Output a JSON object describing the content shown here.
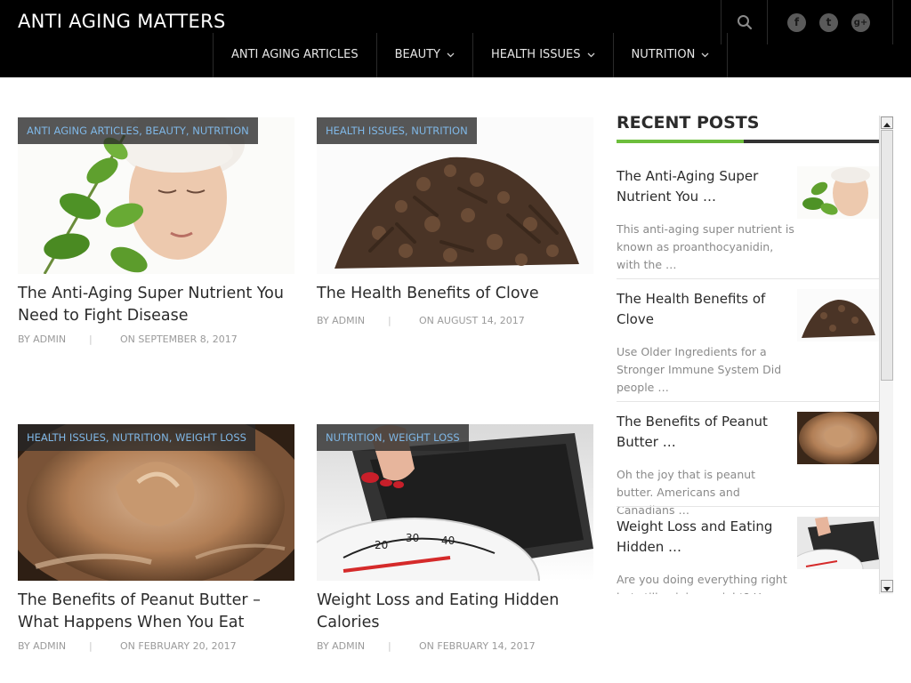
{
  "site": {
    "title": "ANTI AGING MATTERS"
  },
  "header": {
    "search_icon": "search-icon",
    "social": [
      {
        "name": "facebook-icon",
        "glyph": "f"
      },
      {
        "name": "twitter-icon",
        "glyph": "t"
      },
      {
        "name": "google-plus-icon",
        "glyph": "g+"
      }
    ]
  },
  "nav": {
    "items": [
      {
        "label": "ANTI AGING ARTICLES",
        "has_dropdown": false
      },
      {
        "label": "BEAUTY",
        "has_dropdown": true
      },
      {
        "label": "HEALTH ISSUES",
        "has_dropdown": true
      },
      {
        "label": "NUTRITION",
        "has_dropdown": true
      }
    ]
  },
  "articles": [
    {
      "categories": "ANTI AGING ARTICLES, BEAUTY, NUTRITION",
      "title": "The Anti-Aging Super Nutrient You Need to Fight Disease",
      "author": "BY ADMIN",
      "date": "ON SEPTEMBER 8, 2017",
      "image": "woman-with-leaves-image"
    },
    {
      "categories": "HEALTH ISSUES, NUTRITION",
      "title": "The Health Benefits of Clove",
      "author": "BY ADMIN",
      "date": "ON AUGUST 14, 2017",
      "image": "cloves-image"
    },
    {
      "categories": "HEALTH ISSUES, NUTRITION, WEIGHT LOSS",
      "title": "The Benefits of Peanut Butter – What Happens When You Eat",
      "author": "BY ADMIN",
      "date": "ON FEBRUARY 20, 2017",
      "image": "peanut-butter-image"
    },
    {
      "categories": "NUTRITION, WEIGHT LOSS",
      "title": "Weight Loss and Eating Hidden Calories",
      "author": "BY ADMIN",
      "date": "ON FEBRUARY 14, 2017",
      "image": "bathroom-scale-image"
    }
  ],
  "sidebar": {
    "recent_posts_title": "RECENT POSTS",
    "posts": [
      {
        "title": "The Anti-Aging Super Nutrient You …",
        "excerpt": "This anti-aging super nutrient is known as proanthocyanidin, with the …"
      },
      {
        "title": "The Health Benefits of Clove",
        "excerpt": "Use Older Ingredients for a Stronger Immune System Did people …"
      },
      {
        "title": "The Benefits of Peanut Butter …",
        "excerpt": "Oh the joy that is peanut butter. Americans and Canadians …"
      },
      {
        "title": "Weight Loss and Eating Hidden …",
        "excerpt": "Are you doing everything right but still gaining weight? Here …"
      }
    ]
  },
  "colors": {
    "header_bg": "#000000",
    "category_text": "#7fb7e6",
    "accent_green": "#6dbe3c"
  }
}
